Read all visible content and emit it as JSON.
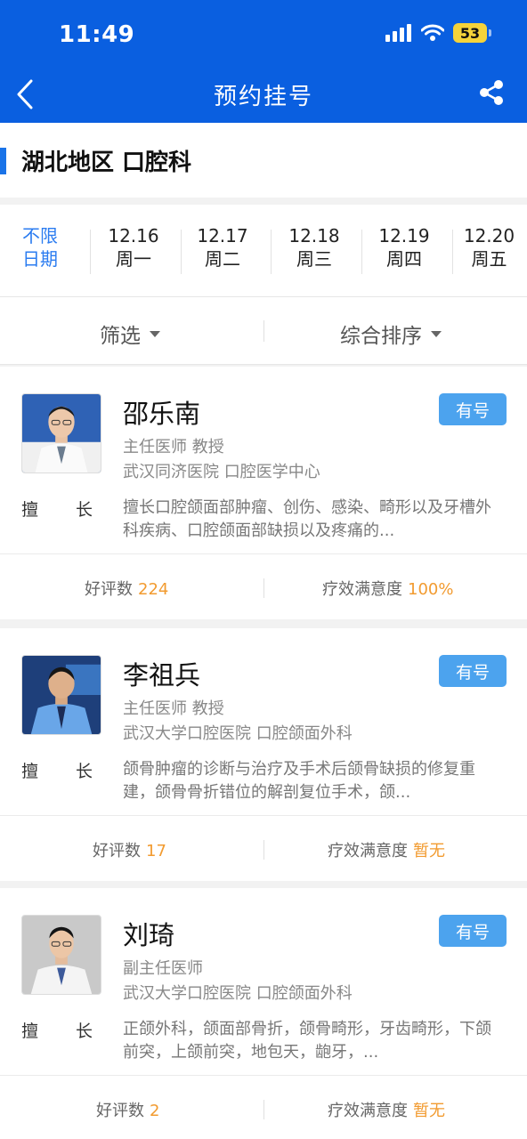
{
  "status": {
    "time": "11:49",
    "battery": "53"
  },
  "nav": {
    "title": "预约挂号"
  },
  "region": {
    "title": "湖北地区 口腔科"
  },
  "dates": {
    "any_line1": "不限",
    "any_line2": "日期",
    "days": [
      {
        "date": "12.16",
        "weekday": "周一"
      },
      {
        "date": "12.17",
        "weekday": "周二"
      },
      {
        "date": "12.18",
        "weekday": "周三"
      },
      {
        "date": "12.19",
        "weekday": "周四"
      },
      {
        "date": "12.20",
        "weekday": "周五"
      }
    ]
  },
  "filters": {
    "filter_label": "筛选",
    "sort_label": "综合排序"
  },
  "doctors": [
    {
      "name": "邵乐南",
      "badge": "有号",
      "title": "主任医师 教授",
      "hospital": "武汉同济医院 口腔医学中心",
      "spec_label_a": "擅",
      "spec_label_b": "长",
      "specialty": "擅长口腔颌面部肿瘤、创伤、感染、畸形以及牙槽外科疾病、口腔颌面部缺损以及疼痛的...",
      "reviews_label": "好评数",
      "reviews": "224",
      "satisfaction_label": "疗效满意度",
      "satisfaction": "100%"
    },
    {
      "name": "李祖兵",
      "badge": "有号",
      "title": "主任医师 教授",
      "hospital": "武汉大学口腔医院 口腔颌面外科",
      "spec_label_a": "擅",
      "spec_label_b": "长",
      "specialty": "颌骨肿瘤的诊断与治疗及手术后颌骨缺损的修复重建，颌骨骨折错位的解剖复位手术，颌...",
      "reviews_label": "好评数",
      "reviews": "17",
      "satisfaction_label": "疗效满意度",
      "satisfaction": "暂无"
    },
    {
      "name": "刘琦",
      "badge": "有号",
      "title": "副主任医师",
      "hospital": "武汉大学口腔医院 口腔颌面外科",
      "spec_label_a": "擅",
      "spec_label_b": "长",
      "specialty": "正颌外科，颌面部骨折，颌骨畸形，牙齿畸形，下颌前突，上颌前突，地包天，龅牙，...",
      "reviews_label": "好评数",
      "reviews": "2",
      "satisfaction_label": "疗效满意度",
      "satisfaction": "暂无"
    }
  ],
  "colors": {
    "header": "#0a5fe0",
    "accent": "#2b7cf0",
    "badge": "#4ca3ee",
    "highlight": "#f29b30"
  }
}
